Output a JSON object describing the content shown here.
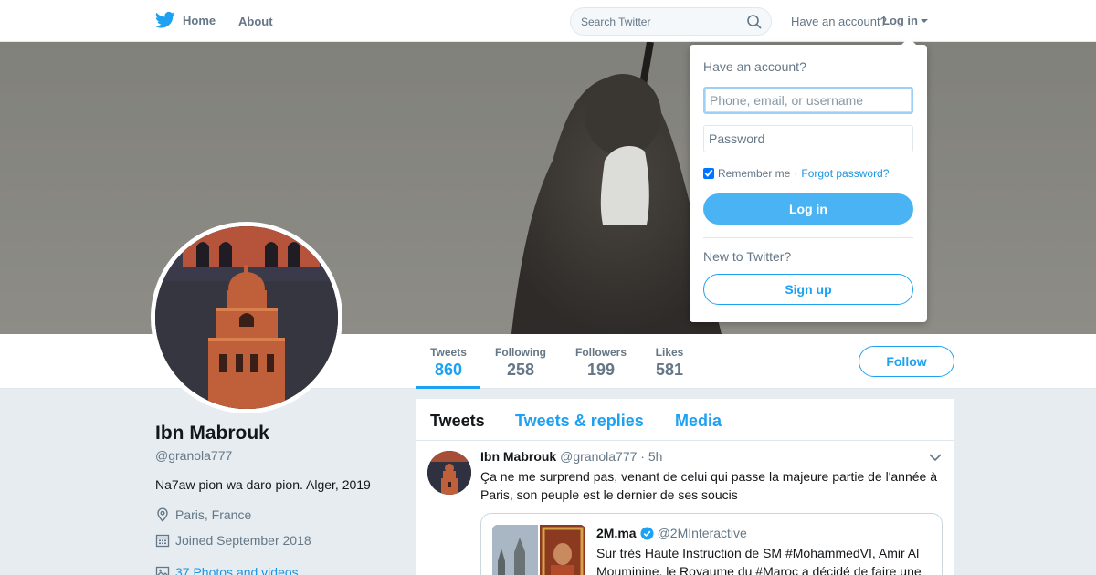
{
  "nav": {
    "home_label": "Home",
    "about_label": "About",
    "search_placeholder": "Search Twitter",
    "have_account": "Have an account?",
    "login_label": "Log in",
    "brand_color": "#1da1f2"
  },
  "profile_nav": {
    "stats": [
      {
        "label": "Tweets",
        "value": "860"
      },
      {
        "label": "Following",
        "value": "258"
      },
      {
        "label": "Followers",
        "value": "199"
      },
      {
        "label": "Likes",
        "value": "581"
      }
    ],
    "follow_label": "Follow"
  },
  "profile": {
    "name": "Ibn Mabrouk",
    "handle": "@granola777",
    "bio": "Na7aw pion wa daro pion. Alger, 2019",
    "location": "Paris, France",
    "joined": "Joined September 2018",
    "photos": "37 Photos and videos"
  },
  "timeline": {
    "tabs": [
      {
        "label": "Tweets"
      },
      {
        "label": "Tweets & replies"
      },
      {
        "label": "Media"
      }
    ],
    "tweet": {
      "name": "Ibn Mabrouk",
      "handle": "@granola777",
      "time": "5h",
      "text": "Ça ne me surprend pas, venant de celui qui passe la majeure partie de l'année à Paris, son peuple est le dernier de ses soucis",
      "quote": {
        "name": "2M.ma",
        "handle": "@2MInteractive",
        "text": "Sur très Haute Instruction de SM #MohammedVI, Amir Al Mouminine, le Royaume du #Maroc a décidé de faire une"
      }
    }
  },
  "login_dropdown": {
    "title": "Have an account?",
    "username_placeholder": "Phone, email, or username",
    "password_placeholder": "Password",
    "remember_label": "Remember me",
    "separator": "·",
    "forgot_label": "Forgot password?",
    "login_button": "Log in",
    "new_to_twitter": "New to Twitter?",
    "signup_button": "Sign up"
  }
}
